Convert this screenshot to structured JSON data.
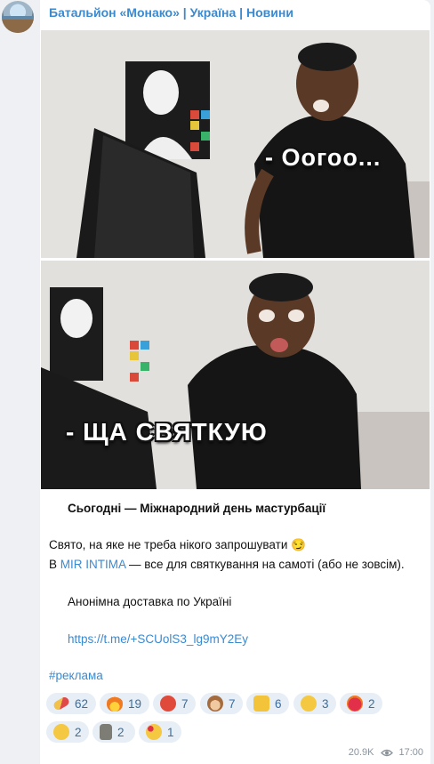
{
  "channel": {
    "title": "Батальйон «Монако» | Україна | Новини"
  },
  "photo": {
    "caption_top": "- Оогоо...",
    "caption_bottom": "- ЩА СВЯТКУЮ"
  },
  "post": {
    "headline": "Сьогодні — Міжнародний день мастурбації",
    "line1": "Свято, на яке не треба нікого запрошувати 😏",
    "line2_prefix": "В ",
    "line2_link": "MIR INTIMA",
    "line2_suffix": " — все для святкування на самоті (або не зовсім).",
    "delivery": "Анонімна доставка по Україні",
    "url": "https://t.me/+SCUolS3_lg9mY2Ey",
    "hashtag": "#реклама"
  },
  "reactions": [
    {
      "icon": "pill-icon",
      "count": "62",
      "color": "#e0a33a"
    },
    {
      "icon": "fire-icon",
      "count": "19",
      "color": "#f07a22"
    },
    {
      "icon": "angry-face-icon",
      "count": "7",
      "color": "#e04a3a"
    },
    {
      "icon": "see-no-evil-monkey-icon",
      "count": "7",
      "color": "#a56b3d"
    },
    {
      "icon": "thumbs-up-icon",
      "count": "6",
      "color": "#f3c43a"
    },
    {
      "icon": "smirk-face-icon",
      "count": "3",
      "color": "#f5c842"
    },
    {
      "icon": "heart-on-fire-icon",
      "count": "2",
      "color": "#e2304a"
    },
    {
      "icon": "thinking-face-icon",
      "count": "2",
      "color": "#f5c842"
    },
    {
      "icon": "moai-icon",
      "count": "2",
      "color": "#7d7d76"
    },
    {
      "icon": "smiling-hearts-face-icon",
      "count": "1",
      "color": "#f5c842"
    }
  ],
  "meta": {
    "views": "20.9K",
    "time": "17:00"
  }
}
